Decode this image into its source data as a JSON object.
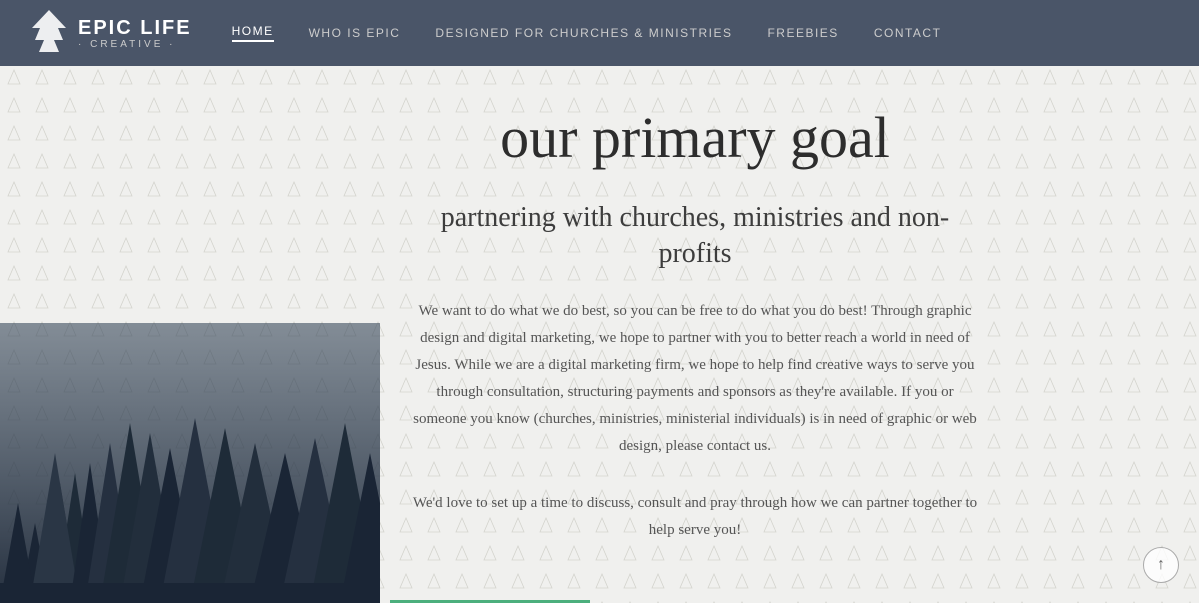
{
  "header": {
    "logo_title": "EPIC LIFE",
    "logo_subtitle": "· CREATIVE ·",
    "nav": {
      "items": [
        {
          "label": "HOME",
          "active": true
        },
        {
          "label": "WHO IS EPIC",
          "active": false
        },
        {
          "label": "DESIGNED FOR CHURCHES & MINISTRIES",
          "active": false
        },
        {
          "label": "FREEBIES",
          "active": false
        },
        {
          "label": "CONTACT",
          "active": false
        }
      ]
    }
  },
  "main": {
    "heading": "our primary goal",
    "subheading": "partnering with churches, ministries and non-profits",
    "body_text": "We want to do what we do best, so you can be free to do what you do best! Through graphic design and digital marketing, we hope to partner with you to better reach a world in need of Jesus. While we are a digital marketing firm, we hope to help find creative ways to serve you through consultation, structuring payments and sponsors as they're available. If you or someone you know (churches, ministries, ministerial individuals) is in need of graphic or web design, please contact us.",
    "cta_text": "We'd love to set up a time to discuss, consult and pray through how we can partner together to help serve you!"
  },
  "scroll_top": "↑"
}
